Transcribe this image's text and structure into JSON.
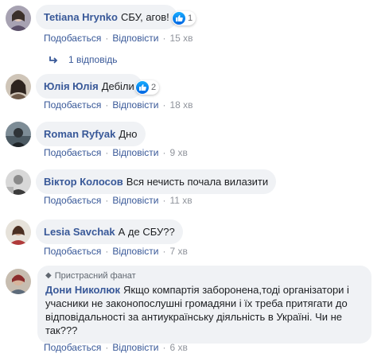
{
  "comments": [
    {
      "author": "Tetiana Hrynko",
      "text": "СБУ, агов!",
      "reactions": "1",
      "like": "Подобається",
      "reply": "Відповісти",
      "time": "15 хв"
    },
    {
      "author": "Юлія Юлія",
      "text": "Дебіли",
      "reactions": "2",
      "like": "Подобається",
      "reply": "Відповісти",
      "time": "18 хв"
    },
    {
      "author": "Roman Ryfyak",
      "text": "Дно",
      "like": "Подобається",
      "reply": "Відповісти",
      "time": "9 хв"
    },
    {
      "author": "Віктор Колосов",
      "text": "Вся нечисть почала вилазити",
      "like": "Подобається",
      "reply": "Відповісти",
      "time": "11 хв"
    },
    {
      "author": "Lesia Savchak",
      "text": "А де СБУ??",
      "like": "Подобається",
      "reply": "Відповісти",
      "time": "7 хв"
    },
    {
      "badge": "Пристрасний фанат",
      "author": "Дони Николюк",
      "text": "Якщо компартія заборонена,тоді організатори і учасники не законопослушні громадяни і їх треба притягати до відповідальності за антиукраїнську діяльність в Україні. Чи не так???",
      "like": "Подобається",
      "reply": "Відповісти",
      "time": "6 хв"
    }
  ],
  "replies_link": "1 відповідь",
  "separator": "·",
  "icons": {
    "like": "thumbs-up-icon",
    "reply": "reply-arrow-icon",
    "badge": "diamond-icon"
  },
  "colors": {
    "link": "#385898",
    "bubble": "#f0f2f5",
    "meta": "#90949c"
  }
}
